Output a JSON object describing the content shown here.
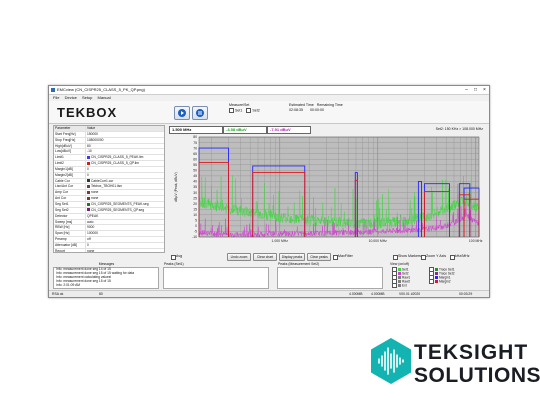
{
  "window": {
    "title": "EMCview (CN_CISPR25_CLASS_5_PK_QP.png)",
    "menus": [
      "File",
      "Device",
      "Setup",
      "Manual"
    ]
  },
  "toolbar": {
    "logo": "TEKBOX",
    "meas_set_label": "Measure/Set",
    "set1_label": "Set1",
    "set2_label": "Set2",
    "est_time_label": "Estimated Time",
    "est_time_value": "02:08:35",
    "remaining_label": "Remaining Time",
    "remaining_value": "00:00:00"
  },
  "params": {
    "headers": [
      "Parameter",
      "Value"
    ],
    "rows": [
      {
        "name": "Start Freq[Hz]",
        "value": "150000"
      },
      {
        "name": "Stop Freq[Hz]",
        "value": "108000000"
      },
      {
        "name": "High[dBuV]",
        "value": "80"
      },
      {
        "name": "Low[dBuV]",
        "value": "-10"
      },
      {
        "name": "Limit1",
        "value": "CN_CISPR25_CLASS_5_PEAK.lim",
        "color": "#3a3aff"
      },
      {
        "name": "Limit2",
        "value": "CN_CISPR25_CLASS_5_QP.lim",
        "color": "#d91a1a"
      },
      {
        "name": "Margin1[dB]",
        "value": "0"
      },
      {
        "name": "Margin2[dB]",
        "value": "0"
      },
      {
        "name": "Cable Cor",
        "value": "CableCorr1.cor",
        "color": "#333333"
      },
      {
        "name": "Lisn/Ant Cor",
        "value": "Tekbox_TBOH01.lisn",
        "color": "#7a3a3a"
      },
      {
        "name": "Amp Cor",
        "value": "none",
        "color": "#7a3a3a"
      },
      {
        "name": "Ant Cor",
        "value": "none",
        "color": "#7a3a3a"
      },
      {
        "name": "Seg Set1",
        "value": "CN_CISPR25_SEGMENTS_PEAK.seg",
        "color": "#1c7a1c"
      },
      {
        "name": "Seg Set2",
        "value": "CN_CISPR25_SEGMENTS_QP.seg",
        "color": "#7a1c7a"
      },
      {
        "name": "Detector",
        "value": "QPEAK"
      },
      {
        "name": "Sweep [ms]",
        "value": "auto"
      },
      {
        "name": "RBW [Hz]",
        "value": "9000"
      },
      {
        "name": "Span [Hz]",
        "value": "100000"
      },
      {
        "name": "Preamp",
        "value": "off"
      },
      {
        "name": "Attenuator [dB]",
        "value": "0"
      },
      {
        "name": "Report",
        "value": "none"
      }
    ]
  },
  "marker": {
    "freq": "1.500 MHz",
    "val1": "-3.58 dBuV",
    "val2": "-7.91 dBuV",
    "val1_color": "#1aa31a",
    "val2_color": "#b21ab2",
    "range": "Set2: 150 KHz > 108.000 MHz"
  },
  "chart_data": {
    "type": "line",
    "xscale": "log",
    "ylabel": "dBµV (Peak, dBuV)",
    "y_ticks": [
      "80",
      "75",
      "70",
      "65",
      "60",
      "55",
      "50",
      "45",
      "40",
      "35",
      "30",
      "25",
      "20",
      "15",
      "10",
      "5",
      "0",
      "-5",
      "-10"
    ],
    "x_ticks": [
      "1.000 MHz",
      "10.000 MHz",
      "100 MHz"
    ],
    "ylim": [
      -10,
      80
    ],
    "colors": {
      "limit1": "#2626ff",
      "limit2": "#dd1a1a",
      "trace1": "#3fd63f",
      "trace2": "#d13fd1",
      "bg": "#bdbdbd",
      "grid": "#8f8f8f"
    },
    "limit1_segments": [
      {
        "x": [
          0.15,
          0.3
        ],
        "y": [
          70,
          70
        ]
      },
      {
        "x": [
          0.53,
          1.8
        ],
        "y": [
          54,
          54
        ]
      },
      {
        "x": [
          5.9,
          6.2
        ],
        "y": [
          48,
          48
        ]
      },
      {
        "x": [
          26,
          28
        ],
        "y": [
          40,
          40
        ]
      },
      {
        "x": [
          30,
          54
        ],
        "y": [
          38,
          38
        ]
      },
      {
        "x": [
          68,
          87
        ],
        "y": [
          38,
          38
        ]
      },
      {
        "x": [
          76,
          108
        ],
        "y": [
          34,
          34
        ]
      }
    ],
    "limit2_segments": [
      {
        "x": [
          0.15,
          0.3
        ],
        "y": [
          57,
          57
        ]
      },
      {
        "x": [
          0.53,
          1.8
        ],
        "y": [
          48,
          48
        ]
      },
      {
        "x": [
          5.9,
          6.2
        ],
        "y": [
          41,
          41
        ]
      },
      {
        "x": [
          30,
          54
        ],
        "y": [
          31,
          31
        ]
      },
      {
        "x": [
          68,
          87
        ],
        "y": [
          28,
          28
        ]
      },
      {
        "x": [
          76,
          108
        ],
        "y": [
          24,
          24
        ]
      }
    ],
    "trace1": {
      "name": "Trace Set1",
      "x": [
        0.15,
        0.3,
        0.5,
        1,
        2,
        5,
        10,
        20,
        30,
        40,
        50,
        60,
        70,
        80,
        90,
        108
      ],
      "y": [
        22,
        15,
        12,
        8,
        5,
        3,
        2,
        4,
        8,
        12,
        15,
        18,
        22,
        24,
        20,
        16
      ]
    },
    "trace2": {
      "name": "Trace Set2",
      "x": [
        0.15,
        0.3,
        0.5,
        1,
        2,
        5,
        10,
        20,
        30,
        40,
        50,
        60,
        70,
        80,
        90,
        108
      ],
      "y": [
        -6,
        -8,
        -8,
        -7,
        -7,
        -6,
        -5,
        -4,
        -3,
        -2,
        0,
        3,
        6,
        9,
        6,
        2
      ]
    },
    "legend_position": "bottom-right"
  },
  "controls": {
    "avg_label": "Avg",
    "undo_zoom": "Undo zoom",
    "clear_chart": "Clear chart",
    "display_peaks": "Display peaks",
    "clear_peaks": "Clear peaks",
    "max_filter": "MaxFilter",
    "show_markers": "Show Markers",
    "zoom_y": "Zoom Y Axis",
    "khz_mhz": "kHz/MHz"
  },
  "messages": {
    "label": "Messages",
    "lines": [
      "Info: measurement done  seg 14 of 15",
      "Info: measurement done  seg 15 of 15 waiting for data",
      "Info: measurement calculating values!",
      "Info: measurement done  seg 15 of 15",
      "Info: 2:01:09 AM"
    ]
  },
  "peaks1": {
    "label": "Peaks (Set1)"
  },
  "peaks2": {
    "label": "Peaks (Measurement Set2)"
  },
  "view": {
    "label": "View (on/off)",
    "items": [
      {
        "label": "Set1",
        "color": "#3fd63f"
      },
      {
        "label": "Set2",
        "color": "#d13fd1"
      },
      {
        "label": "Raw1",
        "color": "#7f7f7f"
      },
      {
        "label": "Raw2",
        "color": "#7f7f7f"
      },
      {
        "label": "Ext",
        "color": "#7f7f7f"
      },
      {
        "label": "Trace Set1",
        "color": "#2d8a2d"
      },
      {
        "label": "Trace Set2",
        "color": "#8a2d8a"
      },
      {
        "label": "Margin1",
        "color": "#2626ff"
      },
      {
        "label": "Margin2",
        "color": "#dd1a1a"
      }
    ]
  },
  "status": {
    "left": "RSA ok",
    "mid": "80",
    "right1": "4.000MB",
    "right2": "4.000MB",
    "ver": "V00.01 #2020",
    "time": "00:03:29"
  },
  "brand": {
    "line1": "TEKSIGHT",
    "line2": "SOLUTIONS",
    "color": "#12b3b0"
  }
}
